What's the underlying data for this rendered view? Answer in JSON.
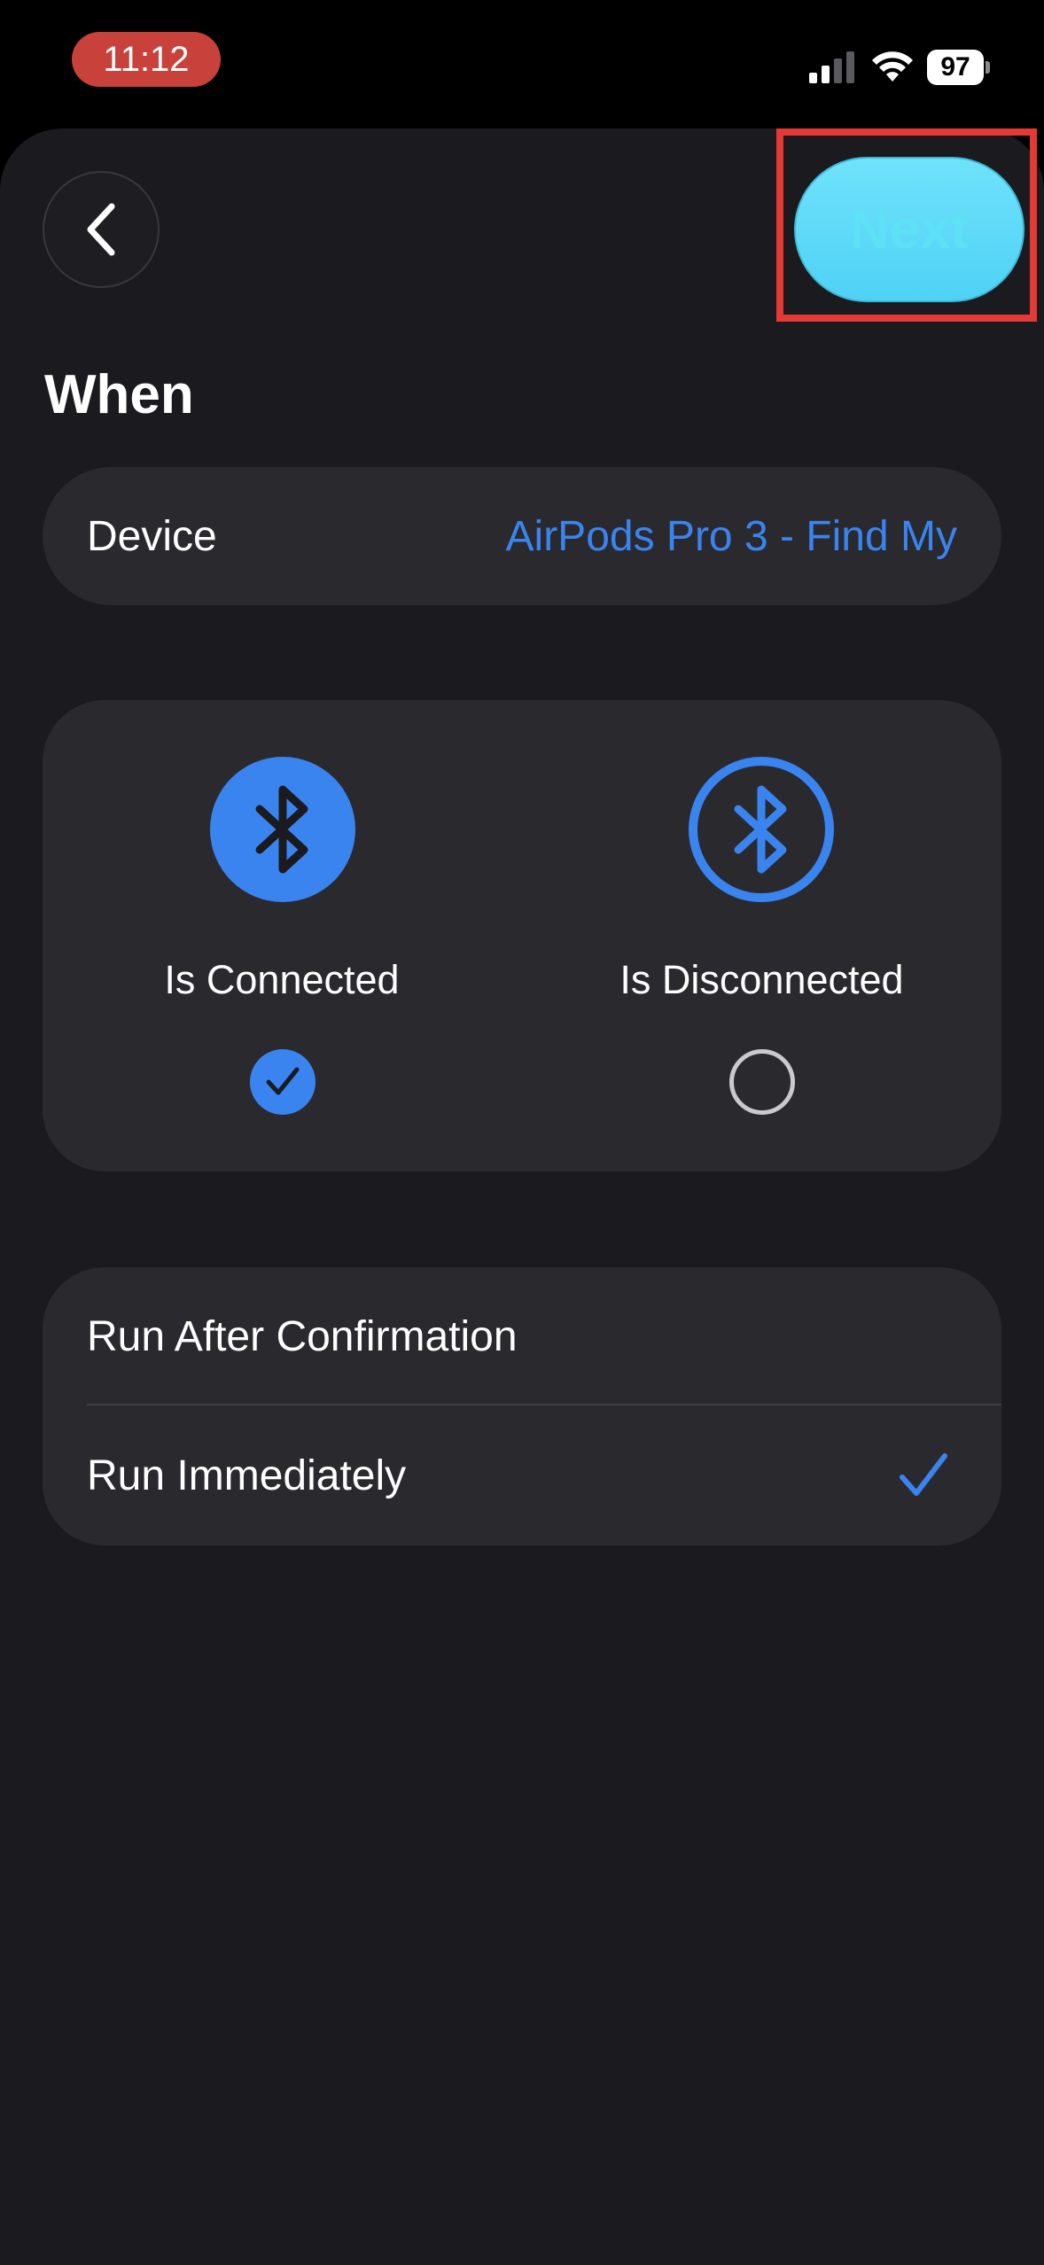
{
  "status_bar": {
    "time": "11:12",
    "battery": "97",
    "time_pill_color": "#c9413b"
  },
  "header": {
    "back_icon": "chevron-left-icon",
    "next_label": "Next",
    "next_color": "#5ee0f7"
  },
  "section": {
    "title": "When"
  },
  "device": {
    "label": "Device",
    "value": "AirPods Pro 3 - Find My",
    "value_color": "#3a84f0"
  },
  "conditions": {
    "options": [
      {
        "label": "Is Connected",
        "icon": "bluetooth-icon",
        "selected": true
      },
      {
        "label": "Is Disconnected",
        "icon": "bluetooth-icon",
        "selected": false
      }
    ]
  },
  "run": {
    "items": [
      {
        "label": "Run After Confirmation",
        "selected": false
      },
      {
        "label": "Run Immediately",
        "selected": true
      }
    ]
  },
  "colors": {
    "accent": "#3a84f0",
    "background": "#1b1b1f",
    "card": "#2a2a2e",
    "highlight_box": "#e53935"
  }
}
